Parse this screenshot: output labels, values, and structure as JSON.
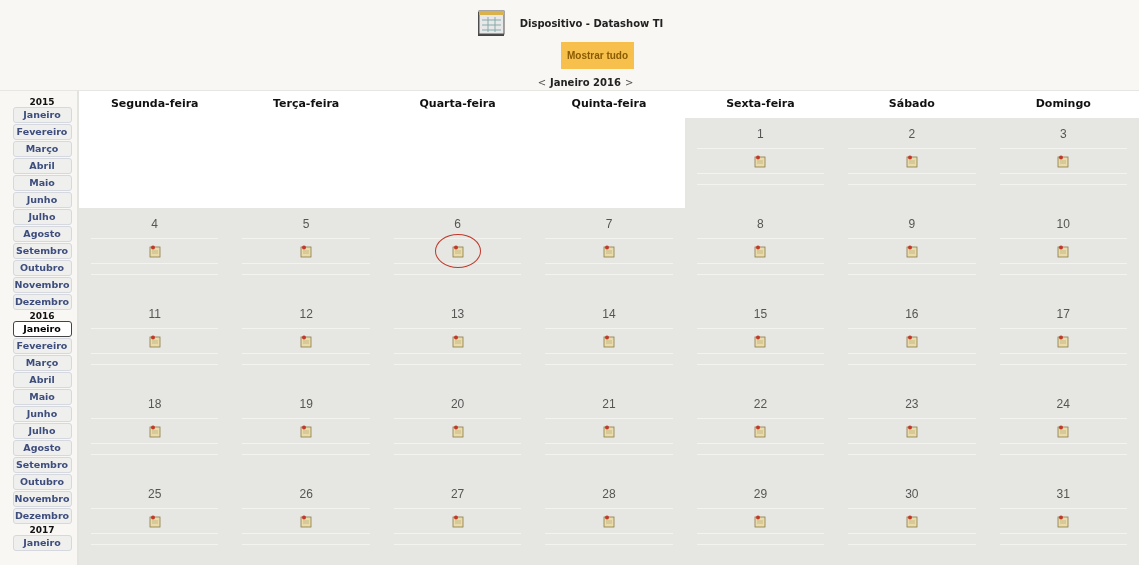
{
  "header": {
    "title": "Dispositivo - Datashow TI",
    "show_all_button": "Mostrar tudo",
    "prev": "<",
    "month": "Janeiro 2016",
    "next": ">"
  },
  "sidebar": [
    {
      "year": "2015",
      "months": [
        {
          "label": "Janeiro",
          "selected": false
        },
        {
          "label": "Fevereiro",
          "selected": false
        },
        {
          "label": "Março",
          "selected": false
        },
        {
          "label": "Abril",
          "selected": false
        },
        {
          "label": "Maio",
          "selected": false
        },
        {
          "label": "Junho",
          "selected": false
        },
        {
          "label": "Julho",
          "selected": false
        },
        {
          "label": "Agosto",
          "selected": false
        },
        {
          "label": "Setembro",
          "selected": false
        },
        {
          "label": "Outubro",
          "selected": false
        },
        {
          "label": "Novembro",
          "selected": false
        },
        {
          "label": "Dezembro",
          "selected": false
        }
      ]
    },
    {
      "year": "2016",
      "months": [
        {
          "label": "Janeiro",
          "selected": true
        },
        {
          "label": "Fevereiro",
          "selected": false
        },
        {
          "label": "Março",
          "selected": false
        },
        {
          "label": "Abril",
          "selected": false
        },
        {
          "label": "Maio",
          "selected": false
        },
        {
          "label": "Junho",
          "selected": false
        },
        {
          "label": "Julho",
          "selected": false
        },
        {
          "label": "Agosto",
          "selected": false
        },
        {
          "label": "Setembro",
          "selected": false
        },
        {
          "label": "Outubro",
          "selected": false
        },
        {
          "label": "Novembro",
          "selected": false
        },
        {
          "label": "Dezembro",
          "selected": false
        }
      ]
    },
    {
      "year": "2017",
      "months": [
        {
          "label": "Janeiro",
          "selected": false
        }
      ]
    }
  ],
  "calendar": {
    "weekdays": [
      "Segunda-feira",
      "Terça-feira",
      "Quarta-feira",
      "Quinta-feira",
      "Sexta-feira",
      "Sábado",
      "Domingo"
    ],
    "weeks": [
      [
        {
          "kind": "empty"
        },
        {
          "kind": "empty"
        },
        {
          "kind": "empty"
        },
        {
          "kind": "empty"
        },
        {
          "kind": "day",
          "number": "1",
          "circled": false
        },
        {
          "kind": "day",
          "number": "2",
          "circled": false
        },
        {
          "kind": "day",
          "number": "3",
          "circled": false
        }
      ],
      [
        {
          "kind": "day",
          "number": "4",
          "circled": false
        },
        {
          "kind": "day",
          "number": "5",
          "circled": false
        },
        {
          "kind": "day",
          "number": "6",
          "circled": true
        },
        {
          "kind": "day",
          "number": "7",
          "circled": false
        },
        {
          "kind": "day",
          "number": "8",
          "circled": false
        },
        {
          "kind": "day",
          "number": "9",
          "circled": false
        },
        {
          "kind": "day",
          "number": "10",
          "circled": false
        }
      ],
      [
        {
          "kind": "day",
          "number": "11",
          "circled": false
        },
        {
          "kind": "day",
          "number": "12",
          "circled": false
        },
        {
          "kind": "day",
          "number": "13",
          "circled": false
        },
        {
          "kind": "day",
          "number": "14",
          "circled": false
        },
        {
          "kind": "day",
          "number": "15",
          "circled": false
        },
        {
          "kind": "day",
          "number": "16",
          "circled": false
        },
        {
          "kind": "day",
          "number": "17",
          "circled": false
        }
      ],
      [
        {
          "kind": "day",
          "number": "18",
          "circled": false
        },
        {
          "kind": "day",
          "number": "19",
          "circled": false
        },
        {
          "kind": "day",
          "number": "20",
          "circled": false
        },
        {
          "kind": "day",
          "number": "21",
          "circled": false
        },
        {
          "kind": "day",
          "number": "22",
          "circled": false
        },
        {
          "kind": "day",
          "number": "23",
          "circled": false
        },
        {
          "kind": "day",
          "number": "24",
          "circled": false
        }
      ],
      [
        {
          "kind": "day",
          "number": "25",
          "circled": false
        },
        {
          "kind": "day",
          "number": "26",
          "circled": false
        },
        {
          "kind": "day",
          "number": "27",
          "circled": false
        },
        {
          "kind": "day",
          "number": "28",
          "circled": false
        },
        {
          "kind": "day",
          "number": "29",
          "circled": false
        },
        {
          "kind": "day",
          "number": "30",
          "circled": false
        },
        {
          "kind": "day",
          "number": "31",
          "circled": false
        }
      ]
    ]
  }
}
